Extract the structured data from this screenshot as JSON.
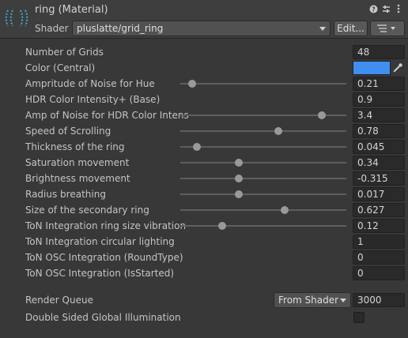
{
  "header": {
    "title": "ring (Material)",
    "shader_label": "Shader",
    "shader_value": "pluslatte/grid_ring",
    "edit_label": "Edit...",
    "icons": [
      "help-icon",
      "preset-icon",
      "more-options-icon",
      "list-icon"
    ]
  },
  "properties": [
    {
      "label": "Number of Grids",
      "value": "48",
      "kind": "field"
    },
    {
      "label": "Color (Central)",
      "kind": "color",
      "color": "#3f8ef0"
    },
    {
      "label": "Ampritude of Noise for Hue",
      "value": "0.21",
      "kind": "slider",
      "fraction": 0.07
    },
    {
      "label": "HDR Color Intensity+ (Base)",
      "value": "0.9",
      "kind": "field"
    },
    {
      "label": "Amp of Noise for HDR Color Intens",
      "value": "3.4",
      "kind": "slider",
      "fraction": 0.85
    },
    {
      "label": "Speed of Scrolling",
      "value": "0.78",
      "kind": "slider",
      "fraction": 0.59
    },
    {
      "label": "Thickness of the ring",
      "value": "0.045",
      "kind": "slider",
      "fraction": 0.1
    },
    {
      "label": "Saturation movement",
      "value": "0.34",
      "kind": "slider",
      "fraction": 0.35
    },
    {
      "label": "Brightness movement",
      "value": "-0.315",
      "kind": "slider",
      "fraction": 0.35
    },
    {
      "label": "Radius breathing",
      "value": "0.017",
      "kind": "slider",
      "fraction": 0.35
    },
    {
      "label": "Size of the secondary ring",
      "value": "0.627",
      "kind": "slider",
      "fraction": 0.63
    },
    {
      "label": "ToN Integration ring size vibration",
      "value": "0.12",
      "kind": "slider",
      "fraction": 0.25
    },
    {
      "label": "ToN Integration circular lighting",
      "value": "1",
      "kind": "field"
    },
    {
      "label": "ToN OSC Integration (RoundType)",
      "value": "0",
      "kind": "field"
    },
    {
      "label": "ToN OSC Integration (IsStarted)",
      "value": "0",
      "kind": "field"
    }
  ],
  "render_queue": {
    "label": "Render Queue",
    "mode": "From Shader",
    "value": "3000"
  },
  "double_sided_gi": {
    "label": "Double Sided Global Illumination",
    "checked": false
  }
}
